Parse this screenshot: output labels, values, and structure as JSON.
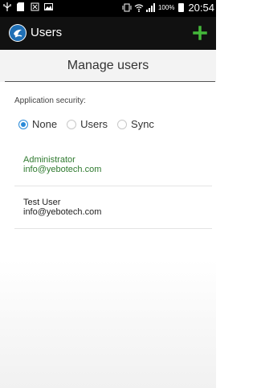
{
  "status_bar": {
    "left_icons": [
      "usb-icon",
      "sd-card-icon",
      "notification-icon",
      "image-icon"
    ],
    "right_icons": [
      "vibrate-icon",
      "wifi-icon",
      "signal-icon"
    ],
    "battery_percent": "100%",
    "time": "20:54"
  },
  "action_bar": {
    "title": "Users",
    "logo_icon": "app-logo-icon",
    "add_icon": "plus-icon",
    "add_color": "#44b83a"
  },
  "header": {
    "title": "Manage users"
  },
  "security": {
    "label": "Application security:",
    "options": [
      {
        "label": "None",
        "selected": true
      },
      {
        "label": "Users",
        "selected": false
      },
      {
        "label": "Sync",
        "selected": false
      }
    ],
    "accent_color": "#2a8ad8"
  },
  "users": [
    {
      "name": "Administrator",
      "email": "info@yebotech.com",
      "color": "#2f7a2f"
    },
    {
      "name": "Test User",
      "email": "info@yebotech.com",
      "color": "#222222"
    }
  ]
}
